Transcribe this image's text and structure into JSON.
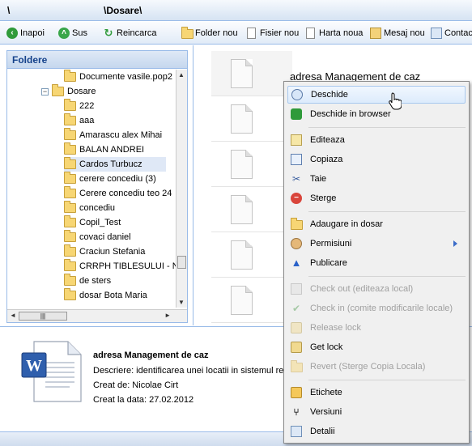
{
  "path": {
    "left": "\\",
    "right": "\\Dosare\\"
  },
  "toolbar": {
    "back": "Inapoi",
    "up": "Sus",
    "reload": "Reincarca",
    "new_folder": "Folder nou",
    "new_file": "Fisier nou",
    "new_map": "Harta noua",
    "new_message": "Mesaj nou",
    "contacts": "Contac"
  },
  "folders_panel": {
    "title": "Foldere",
    "items": [
      {
        "label": "Documente vasile.pop2",
        "level": 2
      },
      {
        "label": "Dosare",
        "level": 1,
        "expanded": true
      },
      {
        "label": "222",
        "level": 2
      },
      {
        "label": "aaa",
        "level": 2
      },
      {
        "label": "Amarascu alex Mihai",
        "level": 2
      },
      {
        "label": "BALAN ANDREI",
        "level": 2
      },
      {
        "label": "Cardos Turbucz",
        "level": 2,
        "selected": true
      },
      {
        "label": "cerere concediu (3)",
        "level": 2
      },
      {
        "label": "Cerere concediu teo 24",
        "level": 2
      },
      {
        "label": "concediu",
        "level": 2
      },
      {
        "label": "Copil_Test",
        "level": 2
      },
      {
        "label": "covaci daniel",
        "level": 2
      },
      {
        "label": "Craciun Stefania",
        "level": 2
      },
      {
        "label": "CRRPH TIBLESULUI - NE",
        "level": 2
      },
      {
        "label": "de sters",
        "level": 2
      },
      {
        "label": "dosar Bota Maria",
        "level": 2
      }
    ]
  },
  "file_list": {
    "selected_title": "adresa Management de caz"
  },
  "context_menu": {
    "items": [
      {
        "label": "Deschide",
        "icon": "magnifier-icon",
        "highlighted": true,
        "disabled": false
      },
      {
        "label": "Deschide in browser",
        "icon": "browser-open-icon",
        "disabled": false
      },
      {
        "label": "Editeaza",
        "icon": "edit-pencil-icon",
        "disabled": false
      },
      {
        "label": "Copiaza",
        "icon": "copy-icon",
        "disabled": false
      },
      {
        "label": "Taie",
        "icon": "scissors-icon",
        "disabled": false
      },
      {
        "label": "Sterge",
        "icon": "delete-icon",
        "disabled": false
      },
      {
        "label": "Adaugare in dosar",
        "icon": "add-to-folder-icon",
        "disabled": false
      },
      {
        "label": "Permisiuni",
        "icon": "permissions-icon",
        "disabled": false,
        "submenu": true
      },
      {
        "label": "Publicare",
        "icon": "publish-icon",
        "disabled": false
      },
      {
        "label": "Check out (editeaza local)",
        "icon": "checkout-icon",
        "disabled": true
      },
      {
        "label": "Check in (comite modificarile locale)",
        "icon": "checkin-icon",
        "disabled": true
      },
      {
        "label": "Release lock",
        "icon": "unlock-icon",
        "disabled": true
      },
      {
        "label": "Get lock",
        "icon": "lock-icon",
        "disabled": false
      },
      {
        "label": "Revert (Sterge Copia Locala)",
        "icon": "revert-icon",
        "disabled": true
      },
      {
        "label": "Etichete",
        "icon": "tags-icon",
        "disabled": false
      },
      {
        "label": "Versiuni",
        "icon": "versions-icon",
        "disabled": false
      },
      {
        "label": "Detalii",
        "icon": "details-icon",
        "disabled": false
      }
    ]
  },
  "details": {
    "title": "adresa Management de caz",
    "description": "Descriere: identificarea unei locatii in sistemul rez",
    "created_by": "Creat de: Nicolae Cirt",
    "created_at": "Creat la data: 27.02.2012"
  },
  "colors": {
    "panel_border": "#99bbe8",
    "panel_title": "#15428b",
    "menu_highlight": "#dcebfc"
  }
}
